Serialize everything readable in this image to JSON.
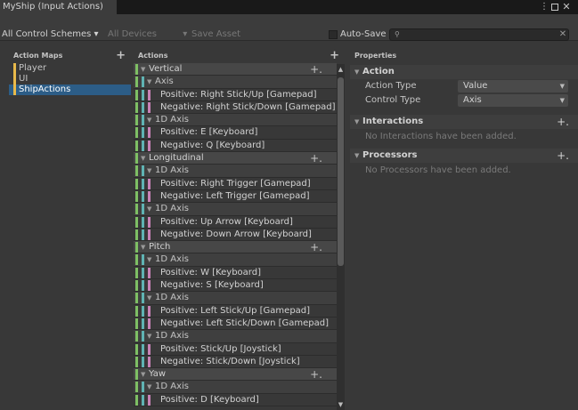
{
  "window": {
    "tab_title": "MyShip (Input Actions)",
    "menu_icon": "kebab-menu-icon",
    "maximize_icon": "maximize-icon",
    "close_icon": "close-icon"
  },
  "toolbar": {
    "control_scheme": "All Control Schemes ▾",
    "devices": "All Devices",
    "devices_arrow": "▾",
    "save_asset": "Save Asset",
    "autosave_label": "Auto-Save",
    "autosave_checked": false,
    "search_value": "",
    "search_icon": "search-icon",
    "clear_icon": "✕"
  },
  "action_maps": {
    "header": "Action Maps",
    "add": "+",
    "items": [
      {
        "label": "Player",
        "selected": false
      },
      {
        "label": "UI",
        "selected": false
      },
      {
        "label": "ShipActions",
        "selected": true
      }
    ]
  },
  "actions": {
    "header": "Actions",
    "add": "+",
    "rows": [
      {
        "type": "action",
        "label": "Vertical",
        "add": "+."
      },
      {
        "type": "comp",
        "label": "Axis"
      },
      {
        "type": "part",
        "label": "Positive: Right Stick/Up [Gamepad]"
      },
      {
        "type": "part",
        "label": "Negative: Right Stick/Down [Gamepad]"
      },
      {
        "type": "comp",
        "label": "1D Axis"
      },
      {
        "type": "part",
        "label": "Positive: E [Keyboard]"
      },
      {
        "type": "part",
        "label": "Negative: Q [Keyboard]"
      },
      {
        "type": "action",
        "label": "Longitudinal",
        "add": "+."
      },
      {
        "type": "comp",
        "label": "1D Axis"
      },
      {
        "type": "part",
        "label": "Positive: Right Trigger [Gamepad]"
      },
      {
        "type": "part",
        "label": "Negative: Left Trigger [Gamepad]"
      },
      {
        "type": "comp",
        "label": "1D Axis"
      },
      {
        "type": "part",
        "label": "Positive: Up Arrow [Keyboard]"
      },
      {
        "type": "part",
        "label": "Negative: Down Arrow [Keyboard]"
      },
      {
        "type": "action",
        "label": "Pitch",
        "add": "+."
      },
      {
        "type": "comp",
        "label": "1D Axis"
      },
      {
        "type": "part",
        "label": "Positive: W [Keyboard]"
      },
      {
        "type": "part",
        "label": "Negative: S [Keyboard]"
      },
      {
        "type": "comp",
        "label": "1D Axis"
      },
      {
        "type": "part",
        "label": "Positive: Left Stick/Up [Gamepad]"
      },
      {
        "type": "part",
        "label": "Negative: Left Stick/Down [Gamepad]"
      },
      {
        "type": "comp",
        "label": "1D Axis"
      },
      {
        "type": "part",
        "label": "Positive: Stick/Up [Joystick]"
      },
      {
        "type": "part",
        "label": "Negative: Stick/Down [Joystick]"
      },
      {
        "type": "action",
        "label": "Yaw",
        "add": "+."
      },
      {
        "type": "comp",
        "label": "1D Axis"
      },
      {
        "type": "part",
        "label": "Positive: D [Keyboard]"
      }
    ]
  },
  "properties": {
    "header": "Properties",
    "action_section": "Action",
    "action_type_label": "Action Type",
    "action_type_value": "Value",
    "control_type_label": "Control Type",
    "control_type_value": "Axis",
    "interactions_section": "Interactions",
    "interactions_add": "+.",
    "interactions_empty": "No Interactions have been added.",
    "processors_section": "Processors",
    "processors_add": "+.",
    "processors_empty": "No Processors have been added."
  }
}
